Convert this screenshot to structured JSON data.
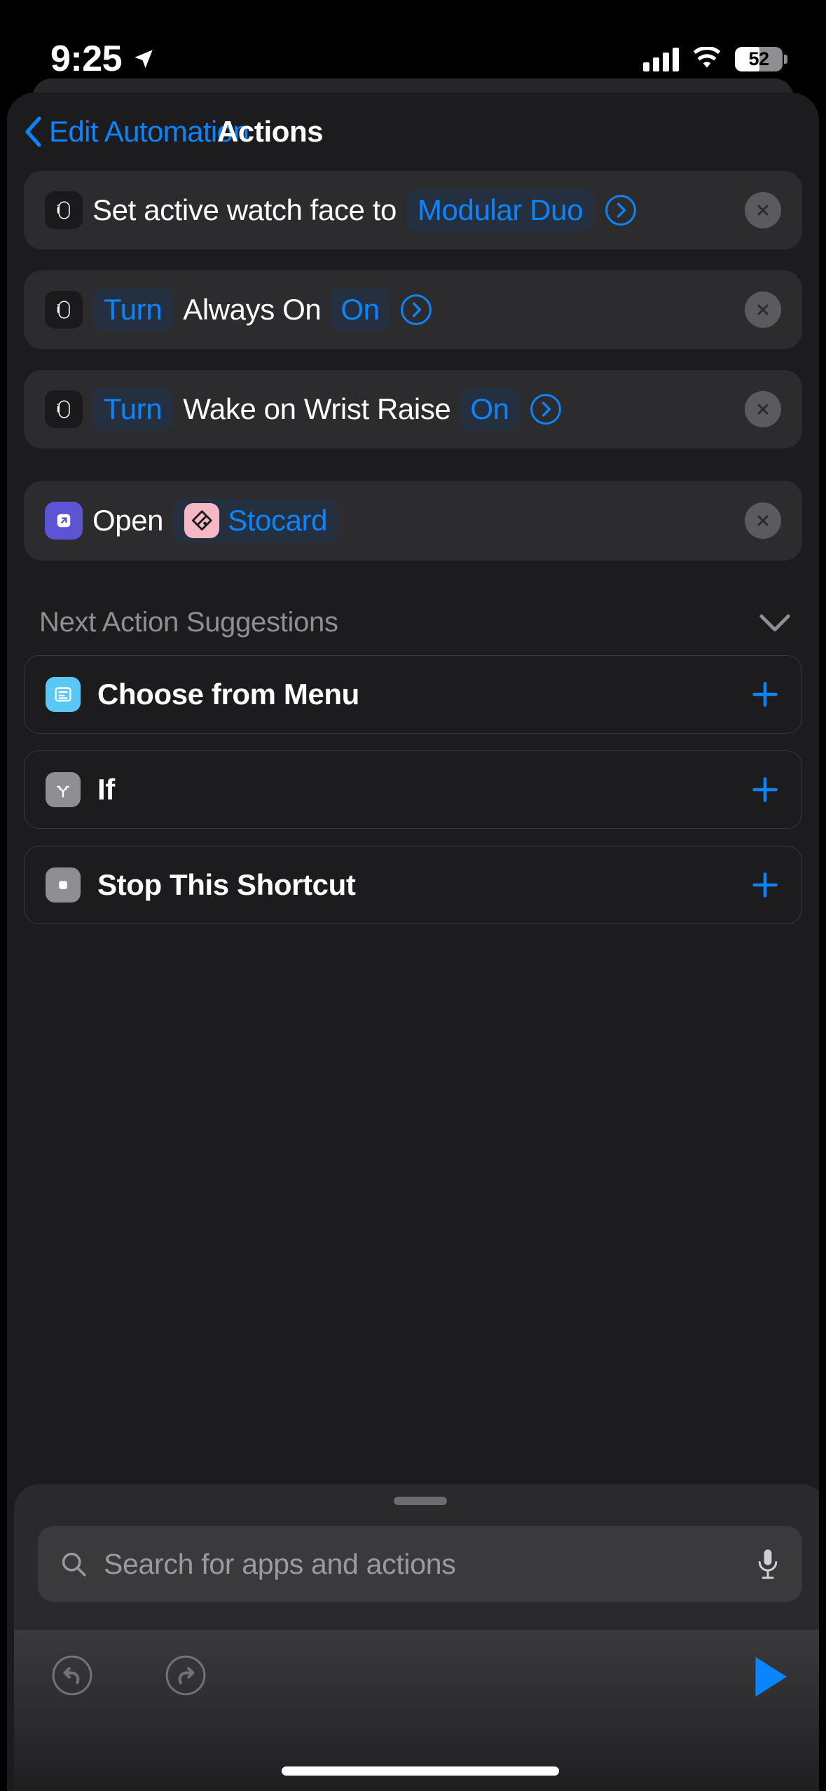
{
  "status_bar": {
    "time": "9:25",
    "location_icon": "location-arrow-icon",
    "cellular_icon": "cellular-bars-icon",
    "wifi_icon": "wifi-icon",
    "battery_percent": "52",
    "battery_level": 52
  },
  "nav": {
    "back_label": "Edit Automation",
    "back_icon": "chevron-left-icon",
    "title": "Actions"
  },
  "actions": [
    {
      "id": "set-watch-face",
      "app_icon": "apple-watch-icon",
      "tokens": [
        {
          "type": "text",
          "value": "Set active watch face to"
        },
        {
          "type": "pill",
          "value": "Modular Duo"
        },
        {
          "type": "chevron",
          "value": "circled-chevron-right-icon"
        }
      ],
      "delete_icon": "close-icon"
    },
    {
      "id": "turn-always-on",
      "app_icon": "apple-watch-icon",
      "tokens": [
        {
          "type": "pill",
          "value": "Turn"
        },
        {
          "type": "text",
          "value": "Always On"
        },
        {
          "type": "pill",
          "value": "On"
        },
        {
          "type": "chevron",
          "value": "circled-chevron-right-icon"
        }
      ],
      "delete_icon": "close-icon"
    },
    {
      "id": "turn-wake-on-wrist-raise",
      "app_icon": "apple-watch-icon",
      "tokens": [
        {
          "type": "pill",
          "value": "Turn"
        },
        {
          "type": "text",
          "value": "Wake on Wrist Raise"
        },
        {
          "type": "pill",
          "value": "On"
        },
        {
          "type": "chevron",
          "value": "circled-chevron-right-icon"
        }
      ],
      "delete_icon": "close-icon"
    },
    {
      "id": "open-stocard",
      "app_icon": "open-app-icon",
      "tokens": [
        {
          "type": "text",
          "value": "Open"
        },
        {
          "type": "pill-app",
          "value": "Stocard",
          "icon": "stocard-app-icon"
        }
      ],
      "delete_icon": "close-icon"
    }
  ],
  "suggestions": {
    "header": "Next Action Suggestions",
    "collapse_icon": "chevron-down-icon",
    "items": [
      {
        "label": "Choose from Menu",
        "icon": "choose-from-menu-icon",
        "add_icon": "plus-icon"
      },
      {
        "label": "If",
        "icon": "if-branch-icon",
        "add_icon": "plus-icon"
      },
      {
        "label": "Stop This Shortcut",
        "icon": "stop-square-icon",
        "add_icon": "plus-icon"
      }
    ]
  },
  "search": {
    "placeholder": "Search for apps and actions",
    "search_icon": "search-icon",
    "mic_icon": "microphone-icon",
    "grabber": "sheet-grabber-handle"
  },
  "toolbar": {
    "undo_icon": "undo-icon",
    "redo_icon": "redo-icon",
    "play_icon": "play-icon"
  },
  "colors": {
    "accent_blue": "#0a84ff",
    "card_bg": "#2c2c2e",
    "sheet_bg": "#1c1c1e",
    "pill_bg": "#243040",
    "secondary_text": "#8e8e93"
  }
}
